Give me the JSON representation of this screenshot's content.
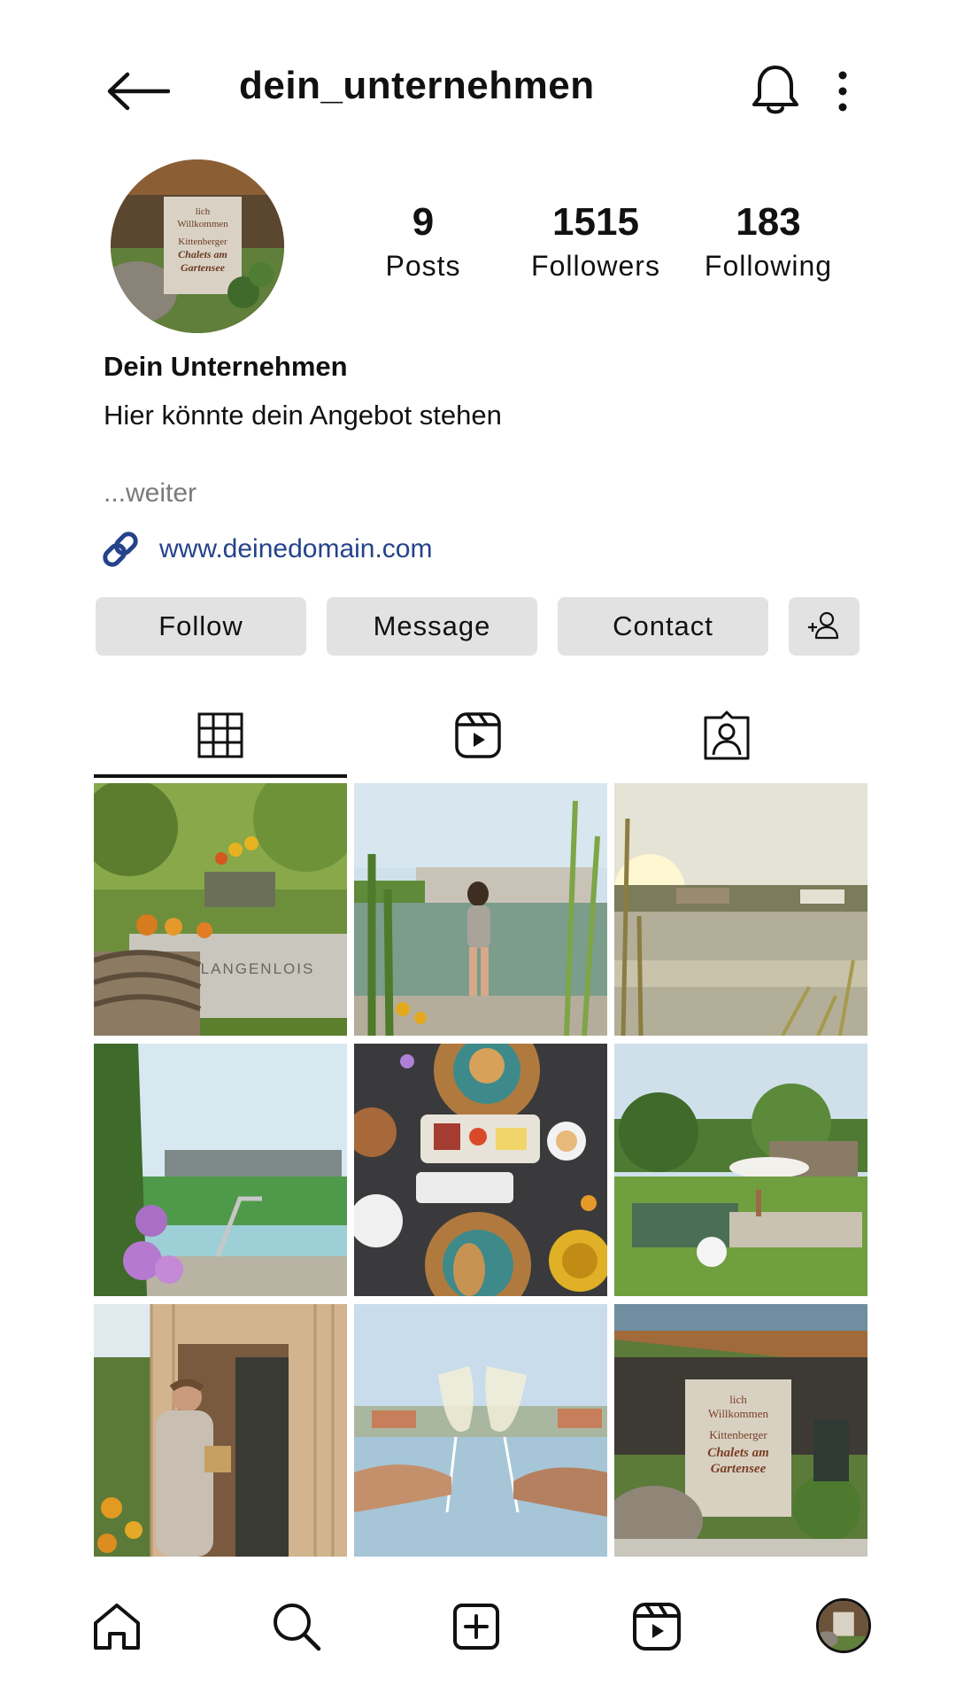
{
  "header": {
    "username": "dein_unternehmen"
  },
  "profile": {
    "stats": [
      {
        "value": "9",
        "label": "Posts"
      },
      {
        "value": "1515",
        "label": "Followers"
      },
      {
        "value": "183",
        "label": "Following"
      }
    ],
    "display_name": "Dein Unternehmen",
    "bio": "Hier könnte dein Angebot stehen",
    "more_label": "...weiter",
    "website": "www.deinedomain.com",
    "avatar_sign_lines": [
      "lich",
      "Willkommen",
      "Kittenberger",
      "Chalets am",
      "Gartensee"
    ]
  },
  "actions": {
    "follow": "Follow",
    "message": "Message",
    "contact": "Contact"
  },
  "tabs": [
    {
      "name": "posts-grid",
      "icon": "grid-icon",
      "active": true
    },
    {
      "name": "reels",
      "icon": "reels-icon",
      "active": false
    },
    {
      "name": "tagged",
      "icon": "tagged-user-icon",
      "active": false
    }
  ],
  "posts": [
    {
      "subject": "garden-display",
      "caption_text": "LANGENLOIS"
    },
    {
      "subject": "woman-at-pond",
      "caption_text": ""
    },
    {
      "subject": "lake-sunset",
      "caption_text": ""
    },
    {
      "subject": "pond-chalets-flowers",
      "caption_text": ""
    },
    {
      "subject": "breakfast-table",
      "caption_text": ""
    },
    {
      "subject": "garden-umbrella",
      "caption_text": ""
    },
    {
      "subject": "sauna-man",
      "caption_text": ""
    },
    {
      "subject": "wine-toast",
      "caption_text": ""
    },
    {
      "subject": "welcome-sign",
      "caption_text": ""
    }
  ],
  "post_sign_lines": [
    "lich",
    "Willkommen",
    "Kittenberger",
    "Chalets am",
    "Gartensee"
  ],
  "bottom_nav": [
    {
      "icon": "home-icon"
    },
    {
      "icon": "search-icon"
    },
    {
      "icon": "create-icon"
    },
    {
      "icon": "reels-icon"
    },
    {
      "icon": "profile-avatar"
    }
  ]
}
